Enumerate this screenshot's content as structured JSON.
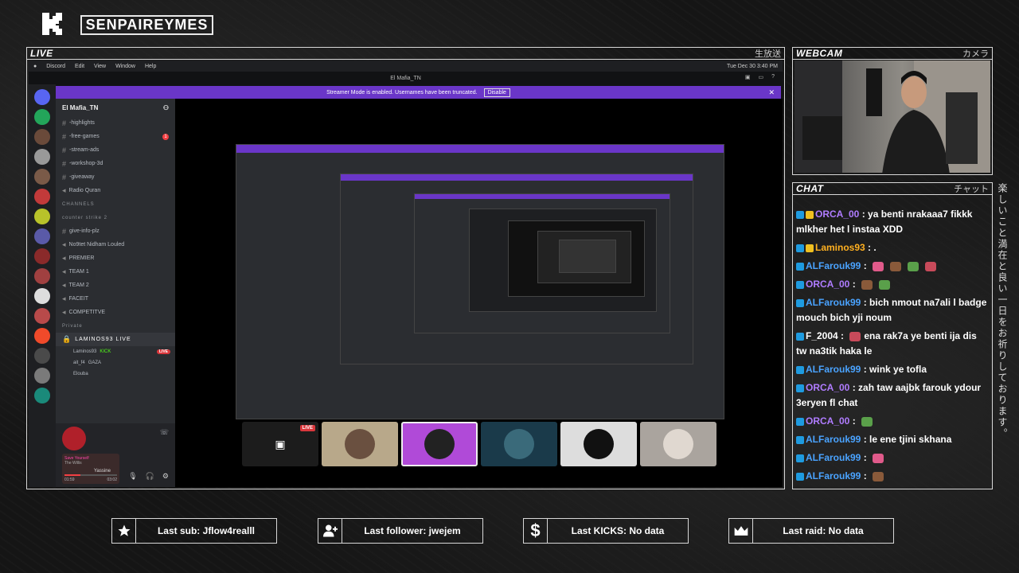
{
  "header": {
    "channel_name": "SENPAIREYMES"
  },
  "side_deco": "楽しいこと満在と良い一日をお祈りしております。",
  "live_panel": {
    "title": "LIVE",
    "title_jp": "生放送"
  },
  "webcam_panel": {
    "title": "WEBCAM",
    "title_jp": "カメラ"
  },
  "chat_panel": {
    "title": "CHAT",
    "title_jp": "チャット"
  },
  "macos_menu": {
    "items": [
      "Discord",
      "Edit",
      "View",
      "Window",
      "Help"
    ],
    "clock": "Tue Dec 30  3:40 PM"
  },
  "discord": {
    "window_title": "El Mafia_TN",
    "banner_text": "Streamer Mode is enabled. Usernames have been truncated.",
    "banner_button": "Disable",
    "server_name": "El Mafia_TN",
    "channels": [
      {
        "name": "-highlights"
      },
      {
        "name": "-free-games",
        "unread": "1"
      },
      {
        "name": "-stream-ads"
      },
      {
        "name": "-workshop-3d"
      },
      {
        "name": "-giveaway"
      },
      {
        "name": "Radio Quran"
      }
    ],
    "category_channels": "CHANNELS",
    "category_counter": "counter strike 2",
    "channels2": [
      {
        "name": "give-info-plz"
      },
      {
        "name": "No9tet Nidham Louled"
      },
      {
        "name": "PREMIER"
      },
      {
        "name": "TEAM 1"
      },
      {
        "name": "TEAM 2"
      },
      {
        "name": "FACEIT"
      },
      {
        "name": "COMPETITVE"
      }
    ],
    "category_private": "Private",
    "voice_channel": "LAMINOS93 LIVE",
    "voice_users": [
      {
        "name": "Laminos93",
        "tag": "KICK",
        "live": "LIVE"
      },
      {
        "name": "ait_f4",
        "tag": "GAZA"
      },
      {
        "name": "Elouba"
      }
    ],
    "player": {
      "title": "Save Yourself",
      "artist": "The Willis",
      "current_time": "01:59",
      "total_time": "03:02",
      "progress": 0.3
    },
    "user_name": "Yassine",
    "streamer_tiles": [
      {
        "live_badge": "LIVE"
      },
      {},
      {},
      {},
      {},
      {}
    ]
  },
  "chat": {
    "messages": [
      {
        "user": "ORCA_00",
        "color": "#b07cff",
        "text": "ya benti nrakaaa7 fikkk mlkher het l instaa XDD",
        "badge": "1"
      },
      {
        "user": "Laminos93",
        "color": "#ffb020",
        "text": ".",
        "badge": "1"
      },
      {
        "user": "ALFarouk99",
        "color": "#4aa3ff",
        "text": "",
        "emotes": 4
      },
      {
        "user": "ORCA_00",
        "color": "#b07cff",
        "text": "",
        "emotes": 2
      },
      {
        "user": "ALFarouk99",
        "color": "#4aa3ff",
        "text": "bich nmout na7ali l badge mouch bich yji noum"
      },
      {
        "user": "F_2004",
        "color": "#ffffff",
        "text": "ena rak7a ye benti ija dis tw na3tik haka le",
        "emotes": 1
      },
      {
        "user": "ALFarouk99",
        "color": "#4aa3ff",
        "text": "wink ye tofla"
      },
      {
        "user": "ORCA_00",
        "color": "#b07cff",
        "text": "zah taw aajbk farouk ydour 3eryen fl chat"
      },
      {
        "user": "ORCA_00",
        "color": "#b07cff",
        "text": "",
        "emotes": 1
      },
      {
        "user": "ALFarouk99",
        "color": "#4aa3ff",
        "text": "le ene tjini skhana"
      },
      {
        "user": "ALFarouk99",
        "color": "#4aa3ff",
        "text": "",
        "emotes": 1
      },
      {
        "user": "ALFarouk99",
        "color": "#4aa3ff",
        "text": "",
        "emotes": 1
      }
    ]
  },
  "stats": [
    {
      "icon": "star-icon",
      "label": "Last sub: Jflow4realll"
    },
    {
      "icon": "user-plus-icon",
      "label": "Last follower: jwejem"
    },
    {
      "icon": "dollar-icon",
      "label": "Last KICKS: No data"
    },
    {
      "icon": "crown-icon",
      "label": "Last raid: No data"
    }
  ]
}
